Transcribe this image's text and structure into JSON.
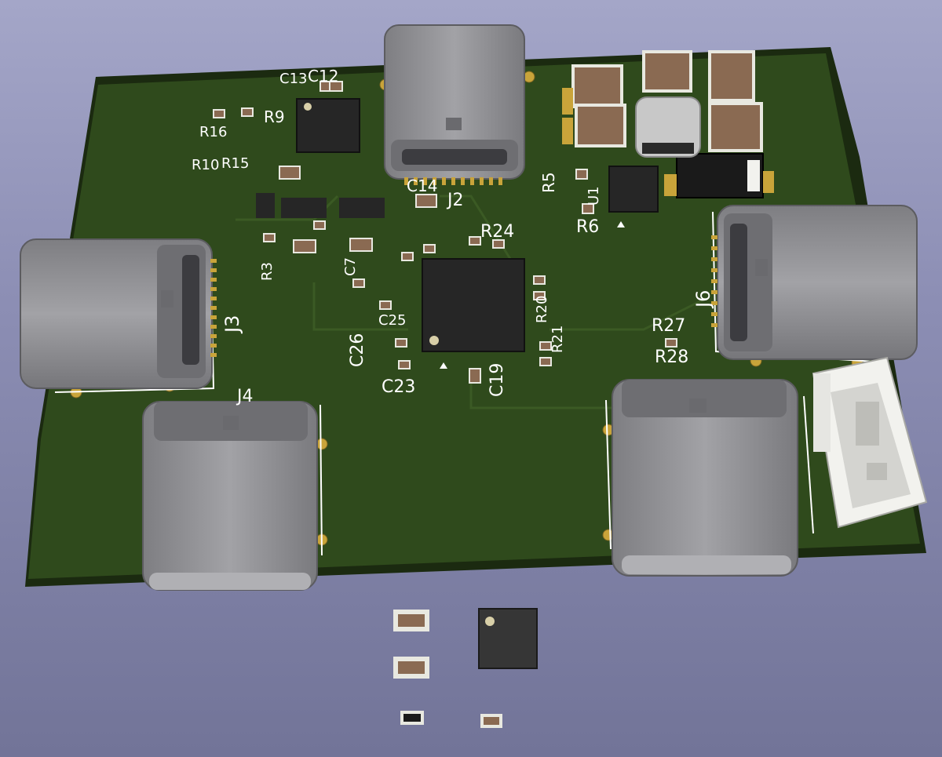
{
  "board": {
    "colors": {
      "background_top": "#a4a6c8",
      "background_bottom": "#727498",
      "soldermask": "#2f4a1c",
      "board_edge": "#1b2a10",
      "silkscreen": "#ffffff",
      "copper_pad": "#c9a43a",
      "usb_c_shell": "#8f8f93",
      "ic_package": "#262626",
      "ceramic_cap": "#8a6a52",
      "inductor": "#c8c8c8",
      "connector_plastic": "#f2f2ee"
    },
    "silkscreen_labels": {
      "j2": "J2",
      "j3": "J3",
      "j4": "J4",
      "j6": "J6",
      "r5": "R5",
      "r6": "R6",
      "r9": "R9",
      "r24": "R24",
      "r27": "R27",
      "r28": "R28",
      "c12": "C12",
      "c14": "C14",
      "c19": "C19",
      "c23": "C23",
      "c26": "C26",
      "r_cluster_left": "R16",
      "r_cluster_left2": "R15",
      "r_cluster_left3": "R10",
      "r_cluster_mid": "R3",
      "c_cluster_mid": "C7",
      "c_cluster_top": "C13",
      "c_cluster_center": "C25",
      "r_cluster_right": "R20",
      "r_cluster_right2": "R21",
      "u_label": "U1"
    },
    "usb_c_ports": [
      "J2",
      "J3",
      "J4",
      "J5",
      "J6"
    ],
    "loose_parts": [
      "capacitor-0603",
      "capacitor-0603",
      "resistor-0402",
      "resistor-0402",
      "qfn-ic"
    ]
  }
}
